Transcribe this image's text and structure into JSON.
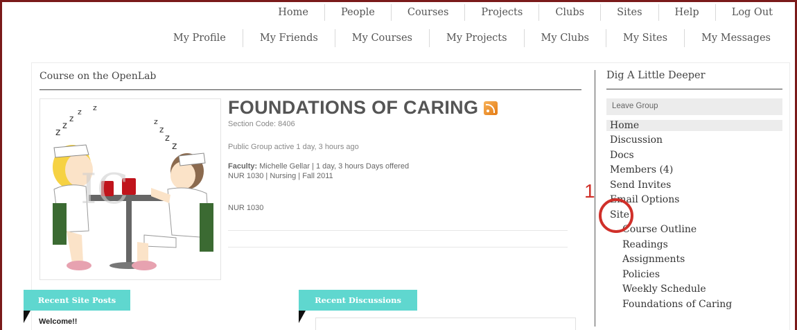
{
  "nav_primary": [
    "Home",
    "People",
    "Courses",
    "Projects",
    "Clubs",
    "Sites",
    "Help",
    "Log Out"
  ],
  "nav_secondary": [
    "My Profile",
    "My Friends",
    "My Courses",
    "My Projects",
    "My Clubs",
    "My Sites",
    "My Messages"
  ],
  "main": {
    "section_title": "Course on the OpenLab",
    "group_name": "FOUNDATIONS OF CARING",
    "section_code": "Section Code: 8406",
    "status": "Public Group active 1 day, 3 hours ago",
    "faculty_label": "Faculty:",
    "faculty_value": "Michelle Gellar | 1 day, 3 hours Days offered",
    "course_line": "NUR 1030 | Nursing | Fall 2011",
    "course_code": "NUR 1030",
    "cover_letters": "IC"
  },
  "sidebar": {
    "title": "Dig A Little Deeper",
    "leave_button": "Leave Group",
    "items": [
      "Home",
      "Discussion",
      "Docs",
      "Members (4)",
      "Send Invites",
      "Email Options",
      "Site"
    ],
    "sub_items": [
      "Course Outline",
      "Readings",
      "Assignments",
      "Policies",
      "Weekly Schedule",
      "Foundations of Caring"
    ]
  },
  "annotation": {
    "number": "1",
    "color": "#d0302a"
  },
  "widgets": {
    "recent_posts": "Recent Site Posts",
    "recent_discussions": "Recent Discussions",
    "first_post": "Welcome!!"
  },
  "colors": {
    "frame": "#7a1a1a",
    "tab": "#5fd7cf",
    "rss": "#e47a12"
  }
}
